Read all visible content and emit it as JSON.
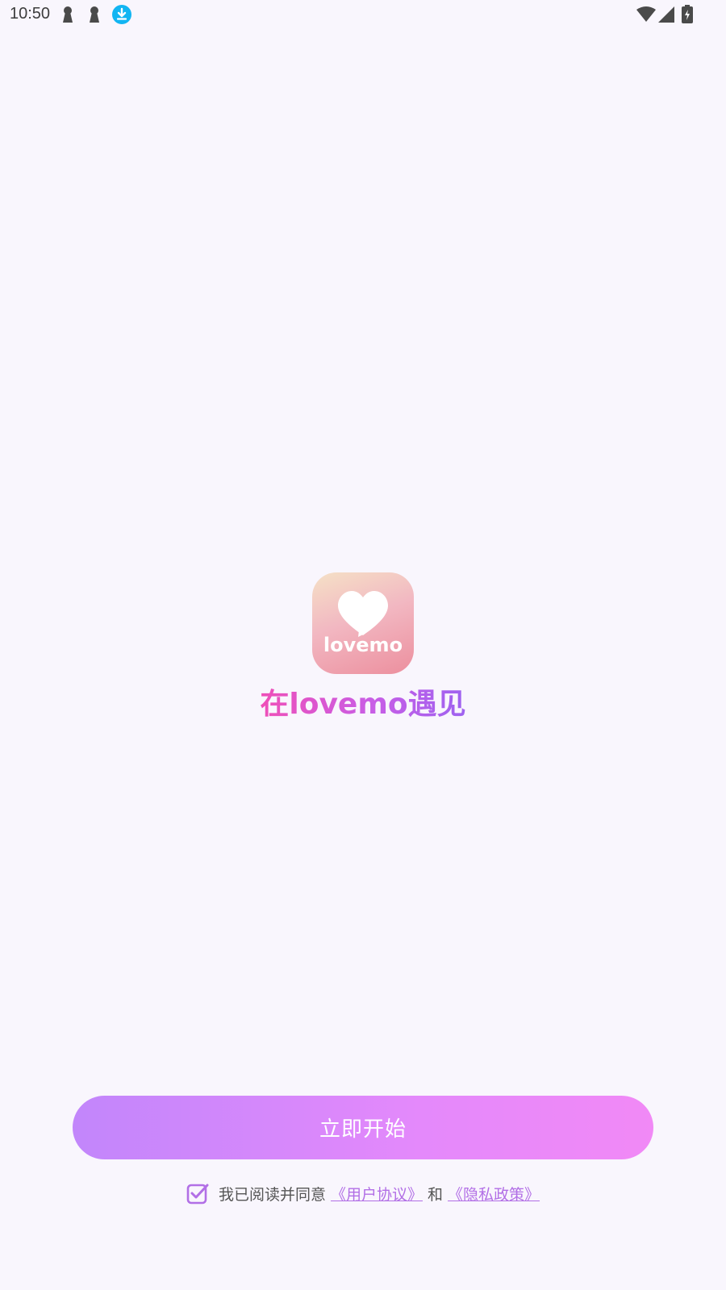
{
  "status_bar": {
    "time": "10:50",
    "icons": [
      "keyhole-icon",
      "keyhole-icon",
      "download-icon",
      "wifi-icon",
      "signal-icon",
      "battery-icon"
    ]
  },
  "logo": {
    "icon": "heart-icon",
    "text": "lovemo"
  },
  "slogan": "在lovemo遇见",
  "start_button": {
    "label": "立即开始"
  },
  "agreement": {
    "checked": true,
    "prefix": "我已阅读并同意",
    "user_agreement": "《用户协议》",
    "conjunction": "和",
    "privacy_policy": "《隐私政策》"
  },
  "colors": {
    "background": "#f9f6fd",
    "accent_purple": "#b26fe6",
    "button_gradient_start": "#c286fb",
    "button_gradient_end": "#f189f6",
    "slogan_pink": "#ef4fb8",
    "slogan_purple": "#9e62f0",
    "download_blue": "#12b5f2"
  }
}
